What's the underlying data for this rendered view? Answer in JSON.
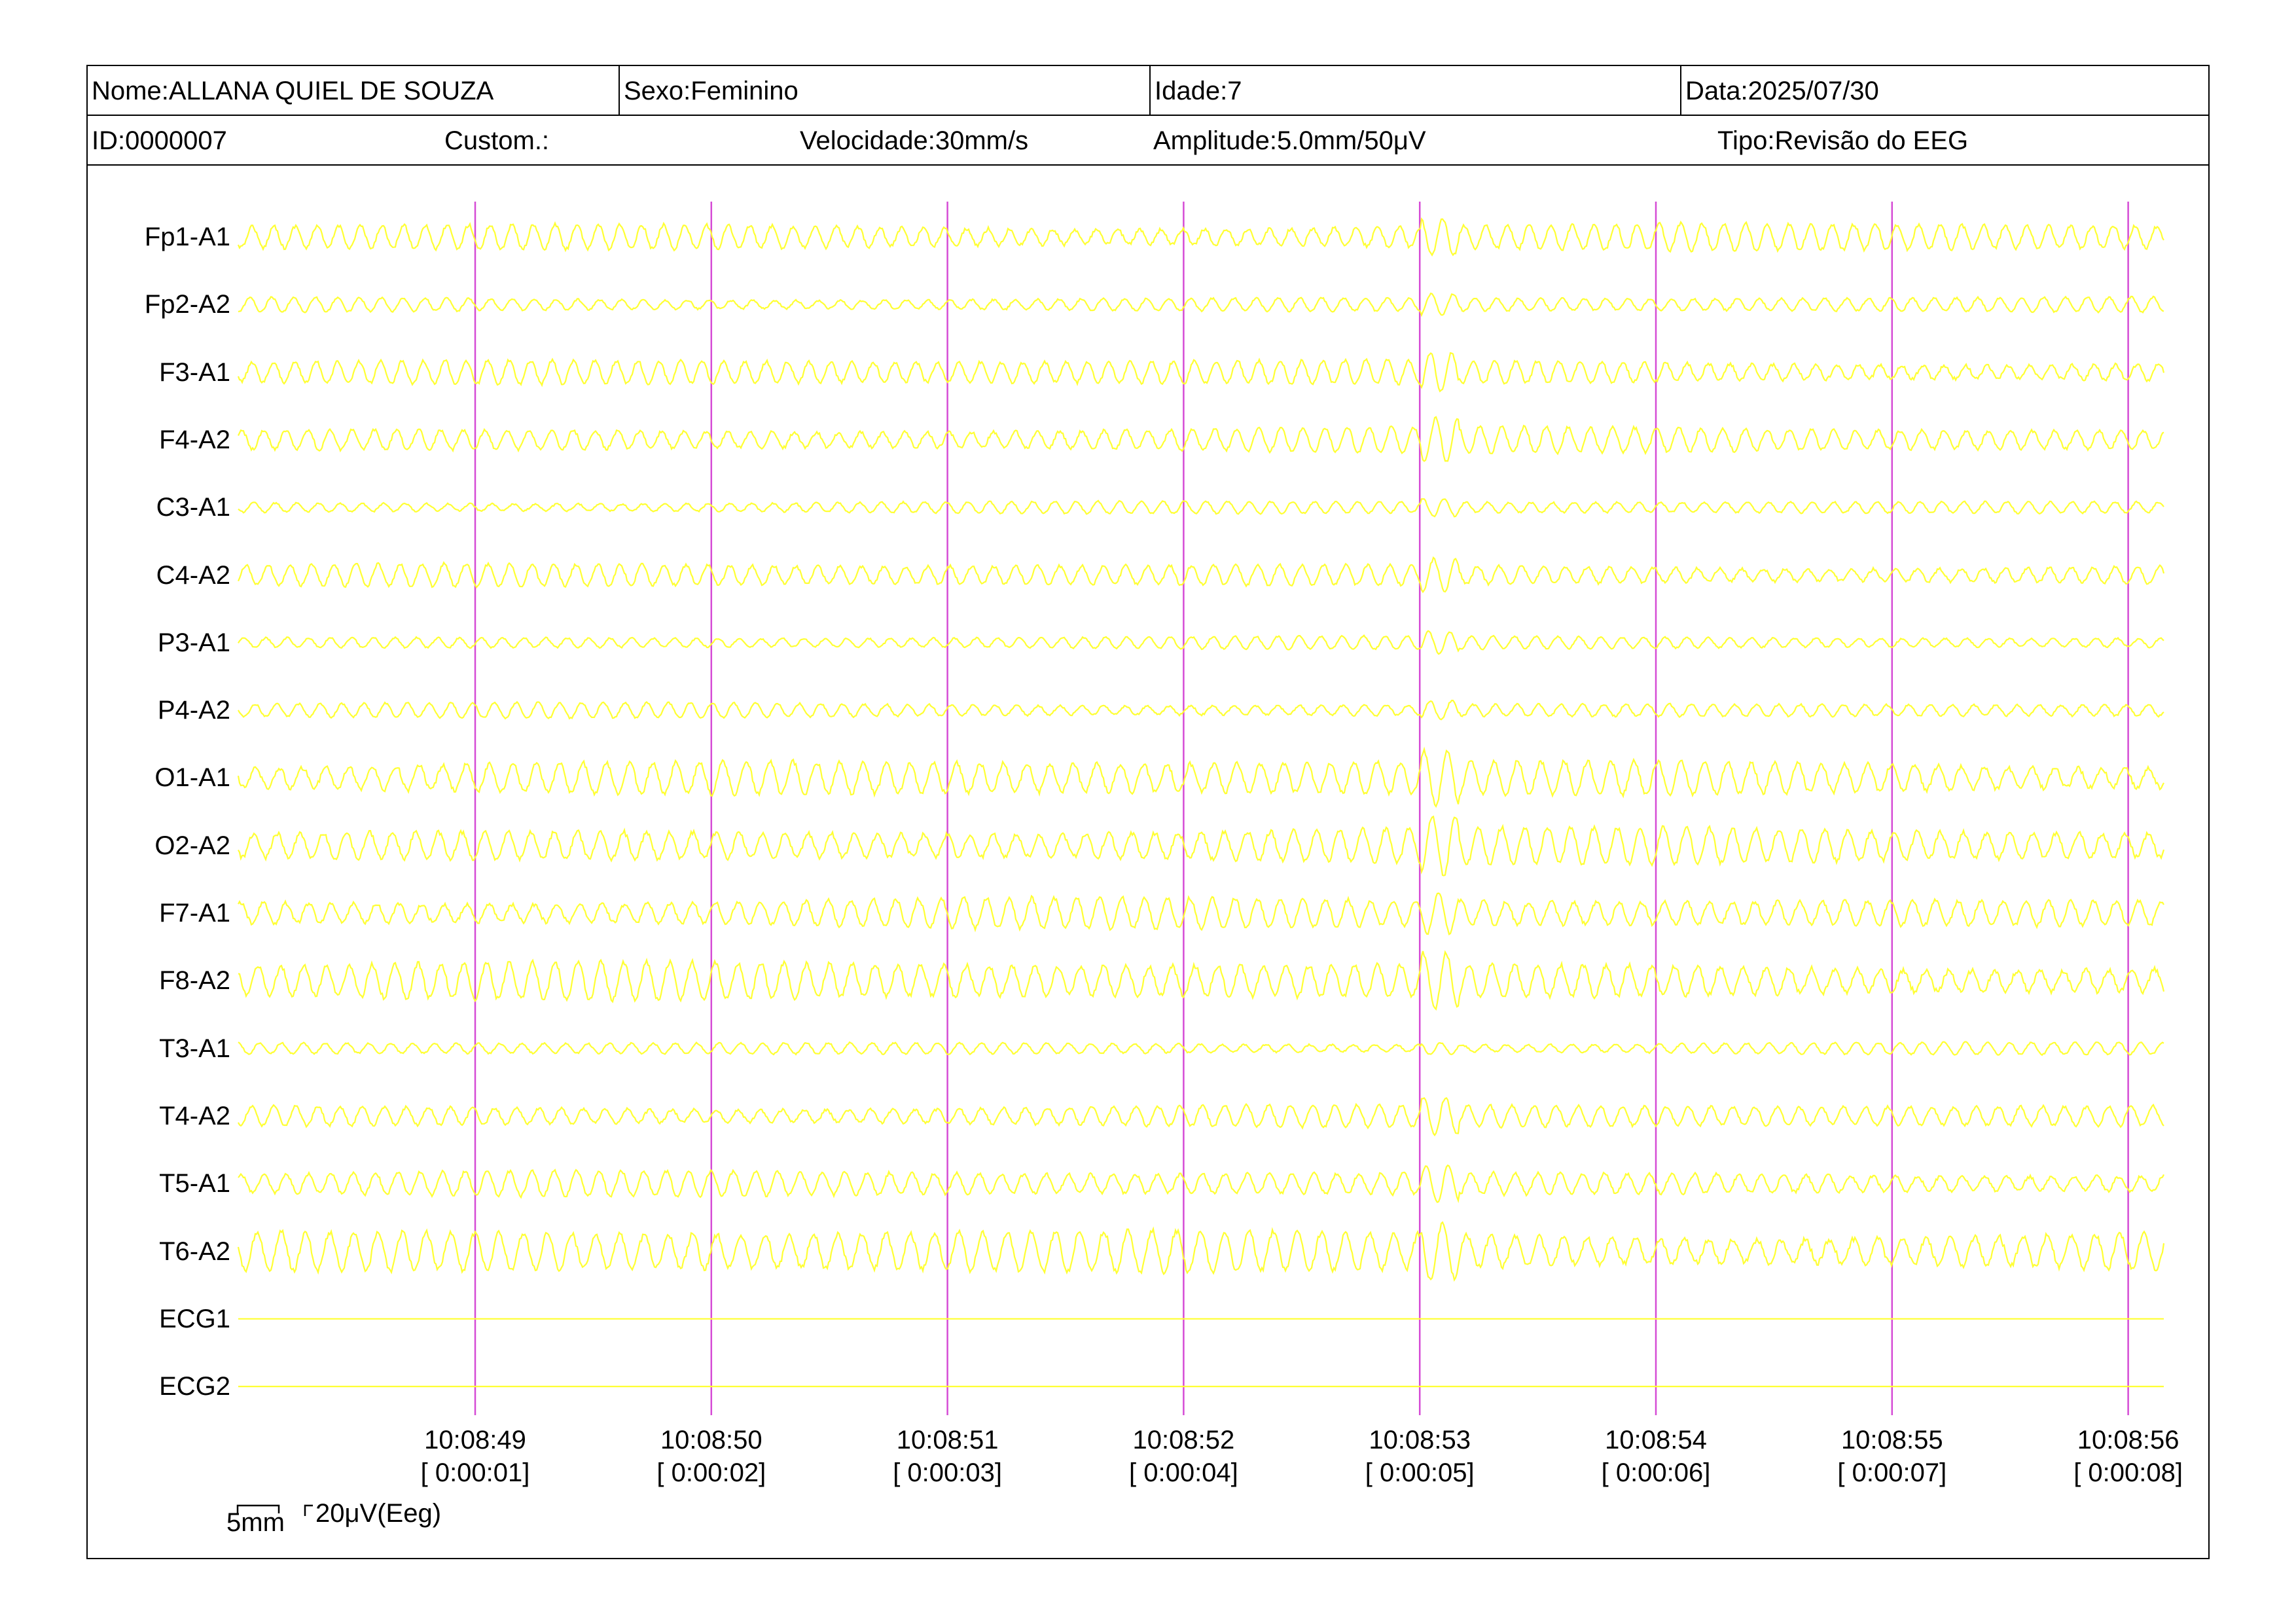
{
  "header": {
    "name": "Nome:ALLANA QUIEL DE SOUZA",
    "sex": "Sexo:Feminino",
    "age": "Idade:7",
    "date": "Data:2025/07/30",
    "id": "ID:0000007",
    "custom": "Custom.:",
    "speed": "Velocidade:30mm/s",
    "amplitude": "Amplitude:5.0mm/50μV",
    "type": "Tipo:Revisão do EEG"
  },
  "channels": [
    {
      "label": "Fp1-A1"
    },
    {
      "label": "Fp2-A2"
    },
    {
      "label": "F3-A1"
    },
    {
      "label": "F4-A2"
    },
    {
      "label": "C3-A1"
    },
    {
      "label": "C4-A2"
    },
    {
      "label": "P3-A1"
    },
    {
      "label": "P4-A2"
    },
    {
      "label": "O1-A1"
    },
    {
      "label": "O2-A2"
    },
    {
      "label": "F7-A1"
    },
    {
      "label": "F8-A2"
    },
    {
      "label": "T3-A1"
    },
    {
      "label": "T4-A2"
    },
    {
      "label": "T5-A1"
    },
    {
      "label": "T6-A2"
    },
    {
      "label": "ECG1"
    },
    {
      "label": "ECG2"
    }
  ],
  "time_marks": [
    {
      "clock": "10:08:49",
      "elapsed": "[ 0:00:01]"
    },
    {
      "clock": "10:08:50",
      "elapsed": "[ 0:00:02]"
    },
    {
      "clock": "10:08:51",
      "elapsed": "[ 0:00:03]"
    },
    {
      "clock": "10:08:52",
      "elapsed": "[ 0:00:04]"
    },
    {
      "clock": "10:08:53",
      "elapsed": "[ 0:00:05]"
    },
    {
      "clock": "10:08:54",
      "elapsed": "[ 0:00:06]"
    },
    {
      "clock": "10:08:55",
      "elapsed": "[ 0:00:07]"
    },
    {
      "clock": "10:08:56",
      "elapsed": "[ 0:00:08]"
    }
  ],
  "scale": {
    "time_label": "5mm",
    "amp_label": "20μV(Eeg)"
  },
  "colors": {
    "trace": "#ffff33",
    "second_marker": "#d54bd5",
    "frame": "#000000",
    "background": "#ffffff"
  }
}
